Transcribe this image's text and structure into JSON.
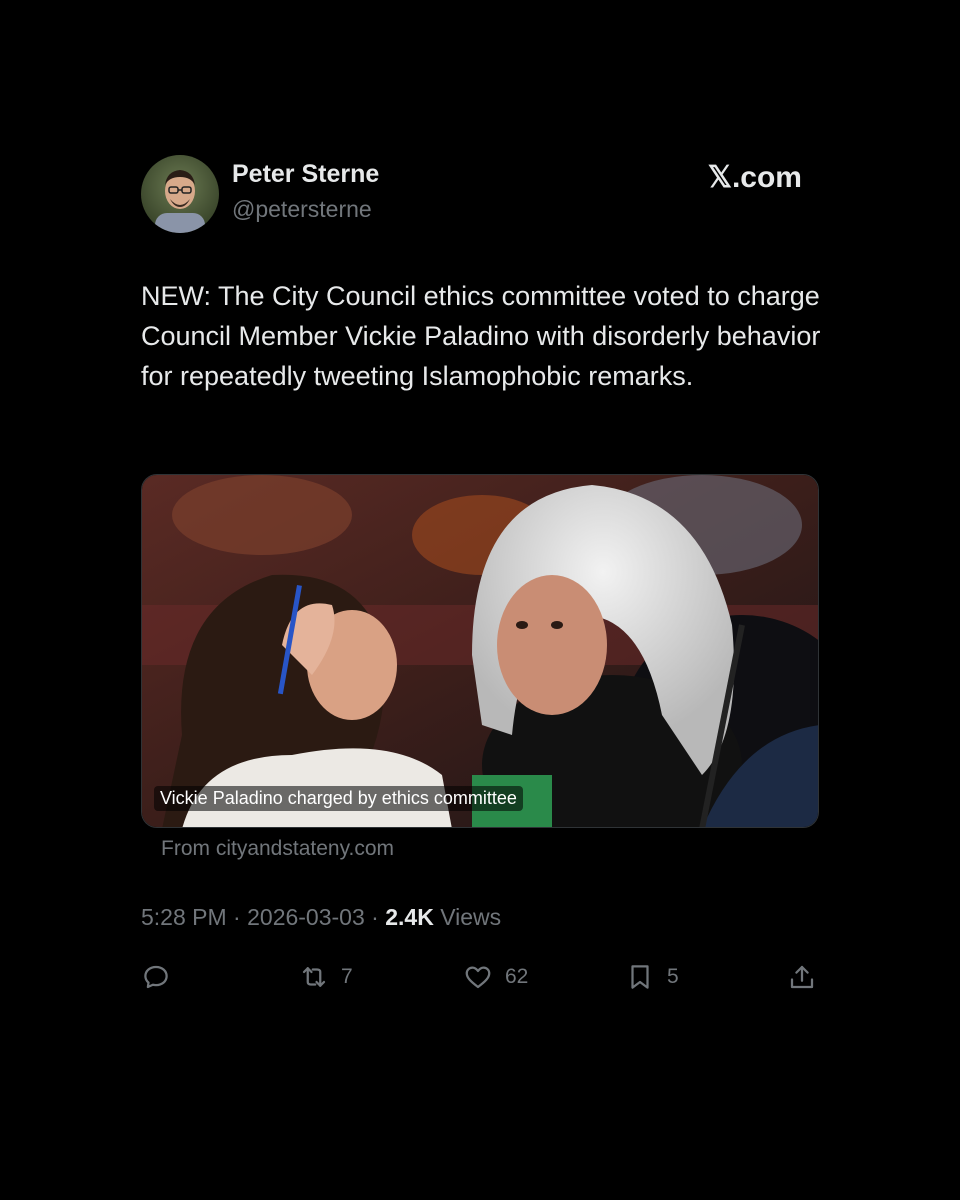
{
  "author": {
    "name": "Peter Sterne",
    "handle": "@petersterne"
  },
  "brand": "𝕏.com",
  "tweet": {
    "text": "NEW: The City Council ethics committee voted to charge Council Member Vickie Paladino with disorderly behavior for repeatedly tweeting Islamophobic remarks."
  },
  "media": {
    "caption": "Vickie Paladino charged by ethics committee",
    "source": "From cityandstateny.com"
  },
  "meta": {
    "time": "5:28 PM",
    "date": "2026-03-03",
    "views_count": "2.4K",
    "views_label": "Views",
    "separator": "·"
  },
  "actions": {
    "reply": {
      "icon": "reply-icon",
      "count": ""
    },
    "repost": {
      "icon": "repost-icon",
      "count": "7"
    },
    "like": {
      "icon": "heart-icon",
      "count": "62"
    },
    "bookmark": {
      "icon": "bookmark-icon",
      "count": "5"
    },
    "share": {
      "icon": "share-icon",
      "count": ""
    }
  },
  "colors": {
    "background": "#000000",
    "text_primary": "#e7e9ea",
    "text_secondary": "#71767b"
  }
}
